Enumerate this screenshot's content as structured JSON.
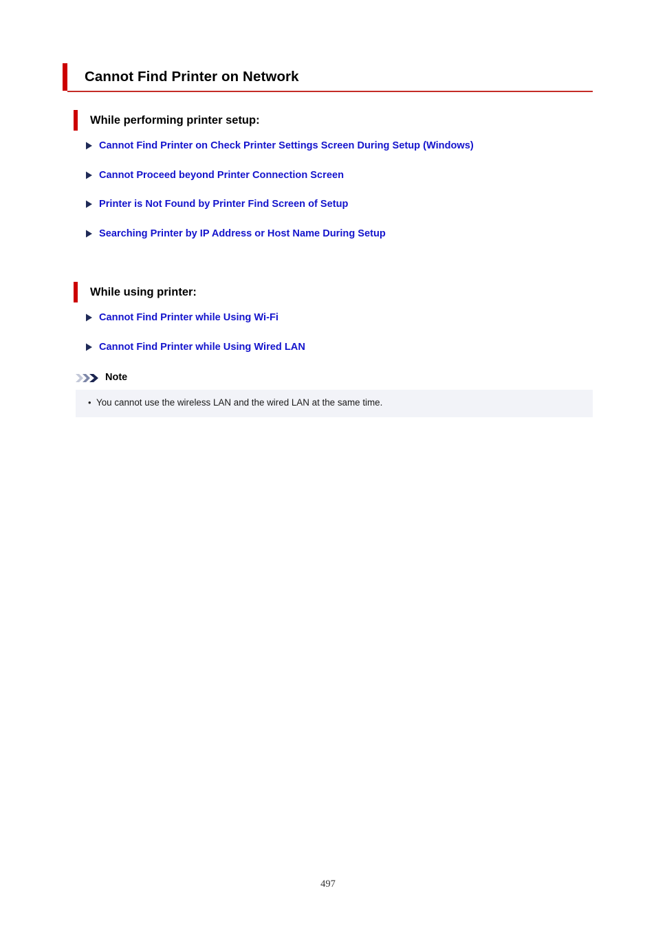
{
  "document": {
    "page_number": "497",
    "title": "Cannot Find Printer on Network"
  },
  "colors": {
    "accent_red": "#cc0000",
    "rule_red": "#c42b26",
    "link_blue": "#1414cc",
    "note_background": "#f2f3f8",
    "arrow_navy": "#1f2a57"
  },
  "sections": [
    {
      "heading": "While performing printer setup:",
      "links": [
        "Cannot Find Printer on Check Printer Settings Screen During Setup (Windows)",
        "Cannot Proceed beyond Printer Connection Screen",
        "Printer is Not Found by Printer Find Screen of Setup",
        "Searching Printer by IP Address or Host Name During Setup"
      ]
    },
    {
      "heading": "While using printer:",
      "links": [
        "Cannot Find Printer while Using Wi-Fi",
        "Cannot Find Printer while Using Wired LAN"
      ]
    }
  ],
  "note": {
    "label": "Note",
    "bullet_glyph": "•",
    "items": [
      "You cannot use the wireless LAN and the wired LAN at the same time."
    ]
  },
  "icons": {
    "arrow": "triangle-right-icon",
    "note": "triple-chevron-icon"
  }
}
